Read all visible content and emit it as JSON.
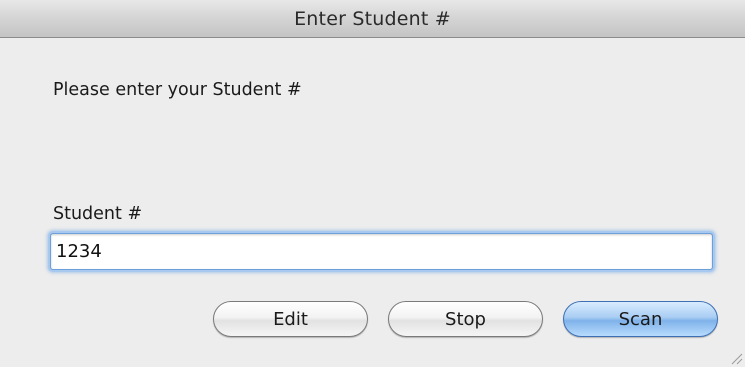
{
  "window": {
    "title": "Enter Student #"
  },
  "dialog": {
    "prompt": "Please enter your Student #",
    "field_label": "Student #",
    "field_value": "1234"
  },
  "buttons": {
    "edit_label": "Edit",
    "stop_label": "Stop",
    "scan_label": "Scan"
  },
  "icons": {
    "resize_grip": "resize-grip-icon"
  },
  "colors": {
    "focus_ring": "#a8c9ef",
    "default_button": "#7fb2ea",
    "window_background": "#ededed"
  }
}
